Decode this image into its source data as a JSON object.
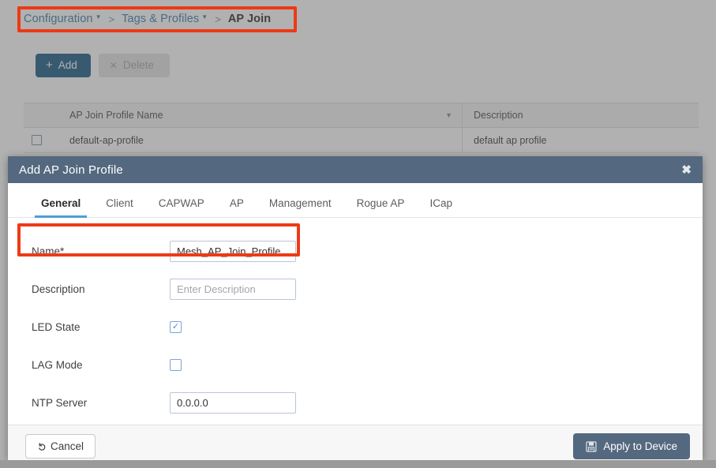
{
  "breadcrumb": {
    "items": [
      {
        "label": "Configuration",
        "has_caret": true,
        "current": false
      },
      {
        "label": "Tags & Profiles",
        "has_caret": true,
        "current": false
      },
      {
        "label": "AP Join",
        "has_caret": false,
        "current": true
      }
    ],
    "separator": ">"
  },
  "toolbar": {
    "add_label": "Add",
    "add_icon": "plus-icon",
    "add_color": "#1c5c87",
    "delete_label": "Delete",
    "delete_icon": "cross-icon",
    "delete_enabled": false
  },
  "table": {
    "columns": [
      {
        "key": "name",
        "label": "AP Join Profile Name",
        "sortable": true,
        "sort_icon": "chevron-down-icon"
      },
      {
        "key": "description",
        "label": "Description",
        "sortable": false
      }
    ],
    "rows": [
      {
        "selected": false,
        "name": "default-ap-profile",
        "description": "default ap profile"
      }
    ]
  },
  "modal": {
    "title": "Add AP Join Profile",
    "close_icon": "close-icon",
    "header_color": "#54697f",
    "tabs": [
      {
        "label": "General",
        "active": true
      },
      {
        "label": "Client",
        "active": false
      },
      {
        "label": "CAPWAP",
        "active": false
      },
      {
        "label": "AP",
        "active": false
      },
      {
        "label": "Management",
        "active": false
      },
      {
        "label": "Rogue AP",
        "active": false
      },
      {
        "label": "ICap",
        "active": false
      }
    ],
    "active_tab_underline_color": "#4f9fd4",
    "fields": [
      {
        "type": "text",
        "label": "Name*",
        "value": "Mesh_AP_Join_Profile",
        "placeholder": ""
      },
      {
        "type": "text",
        "label": "Description",
        "value": "",
        "placeholder": "Enter Description"
      },
      {
        "type": "checkbox",
        "label": "LED State",
        "checked": true,
        "check_glyph": "✓"
      },
      {
        "type": "checkbox",
        "label": "LAG Mode",
        "checked": false,
        "check_glyph": ""
      },
      {
        "type": "text",
        "label": "NTP Server",
        "value": "0.0.0.0",
        "placeholder": ""
      }
    ],
    "footer": {
      "cancel_label": "Cancel",
      "cancel_icon": "undo-arrow-icon",
      "apply_label": "Apply to Device",
      "apply_icon": "save-floppy-icon",
      "apply_color": "#54697f"
    }
  },
  "annotations": {
    "color": "#ed3a16",
    "boxes": [
      {
        "name": "breadcrumb-highlight",
        "target": "breadcrumb"
      },
      {
        "name": "name-field-highlight",
        "target": "modal.fields.0"
      }
    ]
  }
}
